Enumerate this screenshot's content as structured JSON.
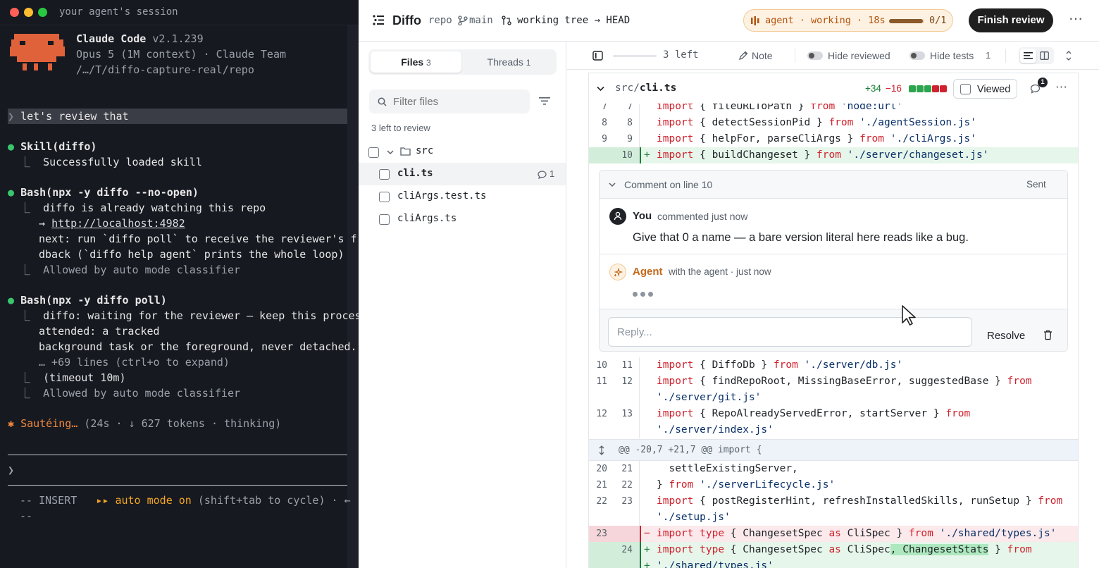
{
  "terminal": {
    "window_title": "your agent's session",
    "app_name": "Claude Code",
    "version": "v2.1.239",
    "model_line": "Opus 5 (1M context) · Claude Team",
    "path": "/…/T/diffo-capture-real/repo",
    "user_prompt": "let's review that",
    "prompt_caret": "❯",
    "skill_call": "Skill(diffo)",
    "skill_result": "Successfully loaded skill",
    "bash1_call": "Bash(npx -y diffo --no-open)",
    "bash1_line1": "diffo is already watching this repo",
    "bash1_arrow": "→",
    "bash1_url": "http://localhost:4982",
    "bash1_line3": "next: run `diffo poll` to receive the reviewer's f",
    "bash1_line4": "dback (`diffo help agent` prints the whole loop)",
    "bash1_allowed": "Allowed by auto mode classifier",
    "bash2_call": "Bash(npx -y diffo poll)",
    "bash2_line1": "diffo: waiting for the reviewer — keep this proces",
    "bash2_line2": "attended: a tracked",
    "bash2_line3": "background task or the foreground, never detached.",
    "bash2_more": "… +69 lines (ctrl+o to expand)",
    "bash2_timeout": "(timeout 10m)",
    "bash2_allowed": "Allowed by auto mode classifier",
    "status_star": "✱",
    "status_verb": "Sautéing…",
    "status_meta": "(24s · ↓ 627 tokens · thinking)",
    "input_caret": "❯",
    "mode_insert": "-- INSERT",
    "mode_arrows": "▸▸",
    "mode_auto": "auto mode on",
    "mode_hint": "(shift+tab to cycle) · ←",
    "mode_tail": "--"
  },
  "header": {
    "app_title": "Diffo",
    "repo": "repo",
    "branch": "main",
    "compare": "working tree → HEAD",
    "agent_status": "agent · working · 18s",
    "agent_count": "0/1",
    "agent_progress": 0.95,
    "finish_label": "Finish review",
    "more": "⋯"
  },
  "sidebar": {
    "tab_files": "Files",
    "tab_files_count": "3",
    "tab_threads": "Threads",
    "tab_threads_count": "1",
    "filter_placeholder": "Filter files",
    "left_to_review": "3 left to review",
    "folder": "src",
    "files": [
      {
        "name": "cli.ts",
        "comments": "1"
      },
      {
        "name": "cliArgs.test.ts",
        "comments": ""
      },
      {
        "name": "cliArgs.ts",
        "comments": ""
      }
    ]
  },
  "toolbar": {
    "left_count": "3 left",
    "progress": 0,
    "note": "Note",
    "hide_reviewed": "Hide reviewed",
    "hide_tests": "Hide tests",
    "hide_tests_count": "1"
  },
  "file": {
    "dir": "src/",
    "name": "cli.ts",
    "additions": "+34",
    "deletions": "−16",
    "viewed_label": "Viewed",
    "comment_badge": "1"
  },
  "diff_top": [
    {
      "old": "7",
      "new": "7",
      "mark": "",
      "code": "import { fileURLToPath } from 'node:url'"
    },
    {
      "old": "8",
      "new": "8",
      "mark": "",
      "code": "import { detectSessionPid } from './agentSession.js'"
    },
    {
      "old": "9",
      "new": "9",
      "mark": "",
      "code": "import { helpFor, parseCliArgs } from './cliArgs.js'"
    },
    {
      "old": "",
      "new": "10",
      "mark": "+",
      "code": "import { buildChangeset } from './server/changeset.js'"
    }
  ],
  "comment": {
    "header": "Comment on line 10",
    "sent": "Sent",
    "author": "You",
    "author_meta": "commented just now",
    "body": "Give that 0 a name — a bare version literal here reads like a bug.",
    "agent_name": "Agent",
    "agent_meta": "with the agent · just now",
    "reply_placeholder": "Reply...",
    "resolve": "Resolve"
  },
  "diff_bottom": [
    {
      "old": "10",
      "new": "11",
      "mark": "",
      "code": "import { DiffoDb } from './server/db.js'"
    },
    {
      "old": "11",
      "new": "12",
      "mark": "",
      "code": "import { findRepoRoot, MissingBaseError, suggestedBase } from"
    },
    {
      "old": "",
      "new": "",
      "mark": "",
      "code": "'./server/git.js'"
    },
    {
      "old": "12",
      "new": "13",
      "mark": "",
      "code": "import { RepoAlreadyServedError, startServer } from"
    },
    {
      "old": "",
      "new": "",
      "mark": "",
      "code": "'./server/index.js'"
    }
  ],
  "hunk": "@@ -20,7 +21,7 @@ import {",
  "diff_hunk2": [
    {
      "old": "20",
      "new": "21",
      "mark": "",
      "code": "  settleExistingServer,"
    },
    {
      "old": "21",
      "new": "22",
      "mark": "",
      "code": "} from './serverLifecycle.js'"
    },
    {
      "old": "22",
      "new": "23",
      "mark": "",
      "code": "import { postRegisterHint, refreshInstalledSkills, runSetup } from"
    },
    {
      "old": "",
      "new": "",
      "mark": "",
      "code": "'./setup.js'"
    },
    {
      "old": "23",
      "new": "",
      "mark": "−",
      "code": "import type { ChangesetSpec as CliSpec } from './shared/types.js'"
    },
    {
      "old": "",
      "new": "24",
      "mark": "+",
      "code": "import type { ChangesetSpec as CliSpec, ChangesetStats } from"
    },
    {
      "old": "",
      "new": "",
      "mark": "+",
      "code": "'./shared/types.js'"
    }
  ],
  "colors": {
    "terminal_bg": "#161920",
    "accent_green": "#1a7f37",
    "accent_red": "#cf222e",
    "agent_orange": "#c2691b",
    "add_bg": "#e6f6ea",
    "del_bg": "#fbe9eb"
  }
}
